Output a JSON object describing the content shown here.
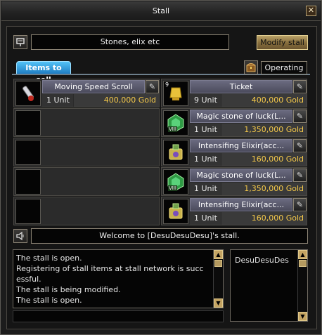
{
  "window": {
    "title": "Stall",
    "close_label": "✕"
  },
  "stall_name": "Stones, elix etc",
  "buttons": {
    "modify": "Modify stall"
  },
  "tab": {
    "label": "Items to sell"
  },
  "status": {
    "label": "Operating"
  },
  "items": [
    {
      "slot": 1,
      "name": "Moving Speed Scroll",
      "units": "1 Unit",
      "price": "400,000 Gold",
      "icon": "scroll-icon"
    },
    {
      "slot": 2,
      "name": "Ticket",
      "units": "9 Unit",
      "price": "400,000 Gold",
      "icon": "ticket-icon",
      "stack": "9"
    },
    {
      "slot": 3,
      "name": "",
      "units": "",
      "price": "",
      "icon": ""
    },
    {
      "slot": 4,
      "name": "Magic stone of luck(L...",
      "units": "1 Unit",
      "price": "1,350,000 Gold",
      "icon": "magic-stone-icon",
      "stack": "VIII"
    },
    {
      "slot": 5,
      "name": "",
      "units": "",
      "price": "",
      "icon": ""
    },
    {
      "slot": 6,
      "name": "Intensifing Elixir(acc...",
      "units": "1 Unit",
      "price": "160,000 Gold",
      "icon": "elixir-icon"
    },
    {
      "slot": 7,
      "name": "",
      "units": "",
      "price": "",
      "icon": ""
    },
    {
      "slot": 8,
      "name": "Magic stone of luck(L...",
      "units": "1 Unit",
      "price": "1,350,000 Gold",
      "icon": "magic-stone-icon",
      "stack": "VIII"
    },
    {
      "slot": 9,
      "name": "",
      "units": "",
      "price": "",
      "icon": ""
    },
    {
      "slot": 10,
      "name": "Intensifing Elixir(acc...",
      "units": "1 Unit",
      "price": "160,000 Gold",
      "icon": "elixir-icon"
    }
  ],
  "welcome_message": "Welcome to [DesuDesuDesu]'s stall.",
  "log_lines": [
    "The stall is open.",
    "Registering of stall items at stall network is succ",
    "essful.",
    "The stall is being modified.",
    "The stall is open."
  ],
  "visitors": [
    "DesuDesuDes"
  ]
}
